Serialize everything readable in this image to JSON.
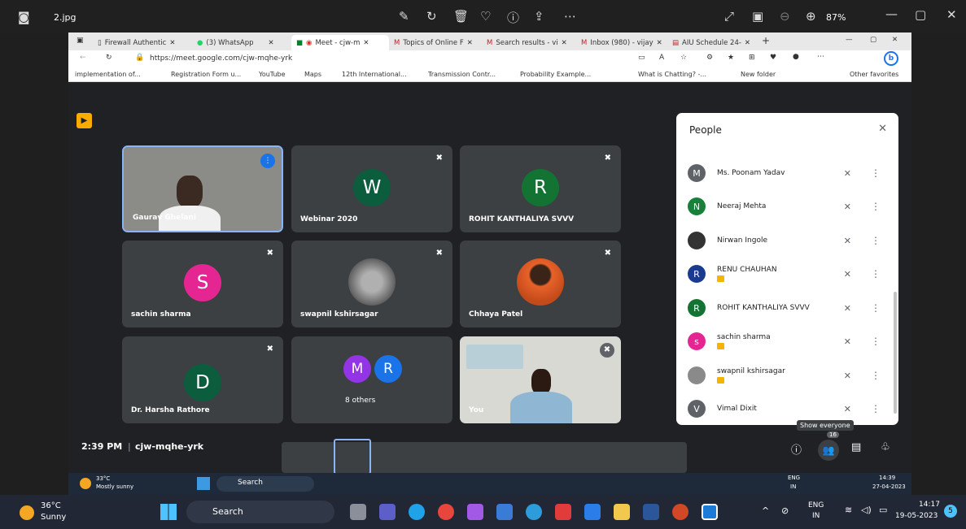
{
  "viewer": {
    "filename": "2.jpg",
    "zoom": "87%"
  },
  "browser": {
    "tabs": [
      {
        "label": "Firewall Authentic"
      },
      {
        "label": "(3) WhatsApp"
      },
      {
        "label": "Meet - cjw-m"
      },
      {
        "label": "Topics of Online F"
      },
      {
        "label": "Search results - vi"
      },
      {
        "label": "Inbox (980) - vijay"
      },
      {
        "label": "AIU Schedule 24-"
      }
    ],
    "url": "https://meet.google.com/cjw-mqhe-yrk",
    "bookmarks": [
      "implementation of...",
      "Registration Form u...",
      "YouTube",
      "Maps",
      "12th International...",
      "Transmission Contr...",
      "Probability Example...",
      "What is Chatting? -...",
      "New folder",
      "Other favorites"
    ]
  },
  "meet": {
    "tiles": [
      {
        "name": "Gaurav Ghelani"
      },
      {
        "name": "Webinar 2020",
        "initial": "W"
      },
      {
        "name": "ROHIT KANTHALIYA SVVV",
        "initial": "R"
      },
      {
        "name": "sachin sharma",
        "initial": "S"
      },
      {
        "name": "swapnil kshirsagar"
      },
      {
        "name": "Chhaya Patel"
      },
      {
        "name": "Dr. Harsha Rathore",
        "initial": "D"
      },
      {
        "name": "8 others",
        "initial_a": "M",
        "initial_b": "R"
      },
      {
        "name": "You"
      }
    ],
    "time": "2:39 PM",
    "separator": "|",
    "meeting_code": "cjw-mqhe-yrk",
    "people_count": "16",
    "tooltip": "Show everyone"
  },
  "people": {
    "title": "People",
    "close": "✕",
    "list": [
      {
        "initial": "M",
        "name": "Ms. Poonam Yadav",
        "color": "#5f6368"
      },
      {
        "initial": "N",
        "name": "Neeraj Mehta",
        "color": "#188038"
      },
      {
        "initial": "",
        "name": "Nirwan Ingole",
        "color": "#333333"
      },
      {
        "initial": "R",
        "name": "RENU CHAUHAN",
        "color": "#1a3a8f"
      },
      {
        "initial": "R",
        "name": "ROHIT KANTHALIYA SVVV",
        "color": "#137333"
      },
      {
        "initial": "s",
        "name": "sachin sharma",
        "color": "#e52592"
      },
      {
        "initial": "",
        "name": "swapnil kshirsagar",
        "color": "#8a8a8a"
      },
      {
        "initial": "V",
        "name": "Vimal Dixit",
        "color": "#5f6368"
      }
    ]
  },
  "inner_taskbar": {
    "temp": "33°C",
    "weather": "Mostly sunny",
    "search": "Search",
    "lang1": "ENG",
    "lang2": "IN",
    "time": "14:39",
    "date": "27-04-2023"
  },
  "taskbar": {
    "temp": "36°C",
    "weather": "Sunny",
    "search": "Search",
    "lang1": "ENG",
    "lang2": "IN",
    "time": "14:17",
    "date": "19-05-2023",
    "notif": "5"
  }
}
